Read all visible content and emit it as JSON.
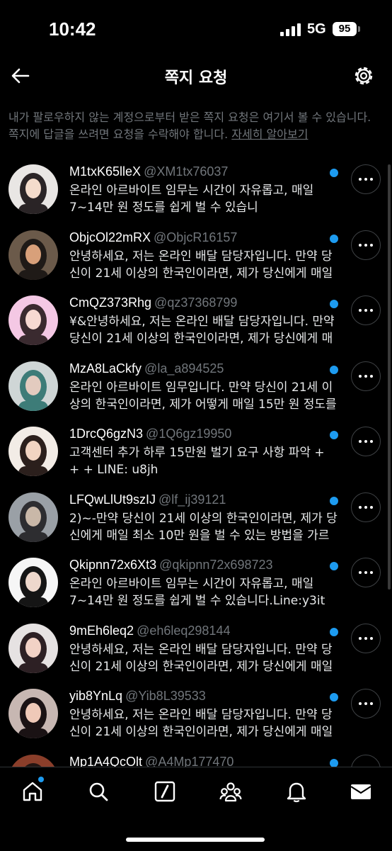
{
  "status": {
    "time": "10:42",
    "network": "5G",
    "battery": "95"
  },
  "header": {
    "title": "쪽지 요청",
    "back_icon": "back-arrow-icon",
    "settings_icon": "gear-icon"
  },
  "notice": {
    "text": "내가 팔로우하지 않는 계정으로부터 받은 쪽지 요청은 여기서 볼 수 있습니다. 쪽지에 답글을 쓰려면 요청을 수락해야 합니다. ",
    "link": "자세히 알아보기"
  },
  "colors": {
    "accent": "#1d9bf0",
    "background": "#000000",
    "muted": "#71767b"
  },
  "requests": [
    {
      "name": "M1txK65lleX",
      "handle": "@XM1tx76037",
      "preview": "온라인 아르바이트 임무는 시간이 자유롭고, 매일 7~14만 원 정도를 쉽게 벌 수 있습니"
    },
    {
      "name": "ObjcOl22mRX",
      "handle": "@ObjcR16157",
      "preview": "안녕하세요, 저는 온라인 배달 담당자입니다. 만약 당신이 21세 이상의 한국인이라면, 제가 당신에게 매일"
    },
    {
      "name": "CmQZ373Rhg",
      "handle": "@qz37368799",
      "preview": "¥&안녕하세요, 저는 온라인 배달 담당자입니다. 만약 당신이 21세 이상의 한국인이라면, 제가 당신에게 매"
    },
    {
      "name": "MzA8LaCkfy",
      "handle": "@la_a894525",
      "preview": "온라인 아르바이트 임무입니다. 만약 당신이 21세 이상의 한국인이라면, 제가 어떻게 매일 15만 원 정도를"
    },
    {
      "name": "1DrcQ6gzN3",
      "handle": "@1Q6gz19950",
      "preview": "고객센터 추가 하루 15만원 벌기 요구 사항 파악 + + + LINE: u8jh"
    },
    {
      "name": "LFQwLlUt9szIJ",
      "handle": "@lf_ij39121",
      "preview": "2)~-만약 당신이 21세 이상의 한국인이라면, 제가 당신에게 매일 최소 10만 원을 벌 수 있는 방법을 가르"
    },
    {
      "name": "Qkipnn72x6Xt3",
      "handle": "@qkipnn72x698723",
      "preview": "온라인 아르바이트 임무는 시간이 자유롭고, 매일 7~14만 원 정도를 쉽게 벌 수 있습니다.Line:y3it"
    },
    {
      "name": "9mEh6leq2",
      "handle": "@eh6leq298144",
      "preview": "안녕하세요, 저는 온라인 배달 담당자입니다. 만약 당신이 21세 이상의 한국인이라면, 제가 당신에게 매일"
    },
    {
      "name": "yib8YnLq",
      "handle": "@Yib8L39533",
      "preview": "안녕하세요, 저는 온라인 배달 담당자입니다. 만약 당신이 21세 이상의 한국인이라면, 제가 당신에게 매일"
    },
    {
      "name": "Mp1A4QcOlt",
      "handle": "@A4Mp177470",
      "preview": ""
    }
  ],
  "tabbar": [
    "home-icon",
    "search-icon",
    "grok-icon",
    "communities-icon",
    "notifications-icon",
    "messages-icon"
  ]
}
